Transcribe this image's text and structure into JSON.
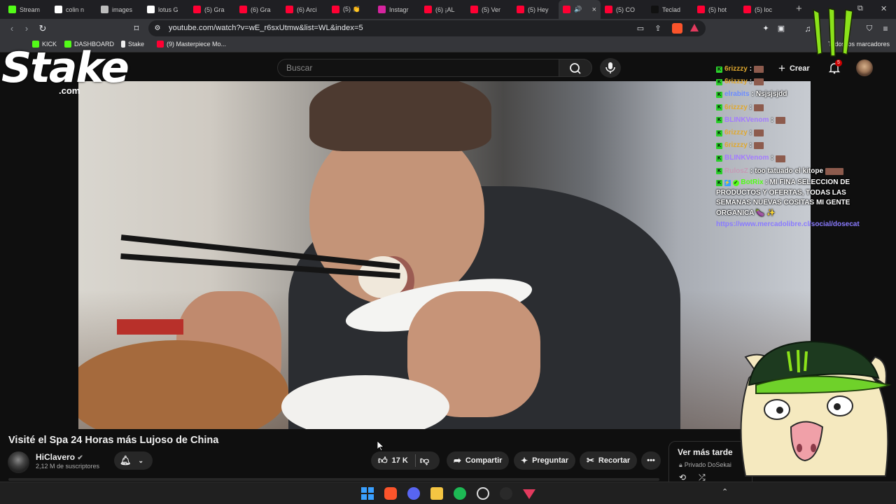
{
  "tabs": [
    {
      "label": "Stream",
      "color": "#53fc18"
    },
    {
      "label": "colin n",
      "color": "#ffffff"
    },
    {
      "label": "images",
      "color": "#bdbdbd"
    },
    {
      "label": "lotus G",
      "color": "#ffffff"
    },
    {
      "label": "(5) Gra",
      "color": "#ff0033"
    },
    {
      "label": "(6) Gra",
      "color": "#ff0033"
    },
    {
      "label": "(6) Arci",
      "color": "#ff0033"
    },
    {
      "label": "(5) 👏",
      "color": "#ff0033"
    },
    {
      "label": "Instagr",
      "color": "#d6249f"
    },
    {
      "label": "(6) ¡AL",
      "color": "#ff0033"
    },
    {
      "label": "(5) Ver",
      "color": "#ff0033"
    },
    {
      "label": "(5) Hey",
      "color": "#ff0033"
    },
    {
      "label": "🔊",
      "color": "#ff0033",
      "active": true
    },
    {
      "label": "(5) CO",
      "color": "#ff0033"
    },
    {
      "label": "Teclad",
      "color": "#111111"
    },
    {
      "label": "(5) hot",
      "color": "#ff0033"
    },
    {
      "label": "(5) loc",
      "color": "#ff0033"
    }
  ],
  "address_bar": {
    "url": "youtube.com/watch?v=wE_r6sxUtmw&list=WL&index=5"
  },
  "bookmarks": [
    {
      "label": "KICK",
      "color": "#53fc18"
    },
    {
      "label": "DASHBOARD",
      "color": "#53fc18"
    },
    {
      "label": "Stake",
      "color": "#ffffff"
    },
    {
      "label": "(9) Masterpiece Mo...",
      "color": "#ff0033"
    }
  ],
  "bookmarks_right": "Todos los marcadores",
  "search": {
    "placeholder": "Buscar"
  },
  "masthead": {
    "create_label": "Crear",
    "notifications_count": "5"
  },
  "chat": [
    {
      "user": "6rizzzy",
      "user_color": "#e0a82e",
      "text": "",
      "emote": true
    },
    {
      "user": "6rizzzy",
      "user_color": "#e0a82e",
      "text": "",
      "emote": true
    },
    {
      "user": "elrabits",
      "user_color": "#6c8cff",
      "text": "Nsjsjsjdd",
      "emote": false
    },
    {
      "user": "6rizzzy",
      "user_color": "#e0a82e",
      "text": "",
      "emote": true
    },
    {
      "user": "BLINKVenom",
      "user_color": "#a37bff",
      "text": "",
      "emote": true
    },
    {
      "user": "6rizzzy",
      "user_color": "#e0a82e",
      "text": "",
      "emote": true
    },
    {
      "user": "6rizzzy",
      "user_color": "#e0a82e",
      "text": "",
      "emote": true
    },
    {
      "user": "BLINKVenom",
      "user_color": "#a37bff",
      "text": "",
      "emote": true
    },
    {
      "user": "RulosZ",
      "user_color": "#c59bb5",
      "text": "too tatuado el kitope",
      "emote": true
    }
  ],
  "bot_message": {
    "user": "BotRix",
    "user_color": "#53fc18",
    "text": "MI FINA SELECCION DE PRODUCTOS Y OFERTAS, TODAS LAS SEMANAS NUEVAS COSITAS MI GENTE ORGANICA 🍆 ✨",
    "link": "https://www.mercadolibre.cl/social/dosecat"
  },
  "video": {
    "title": "Visité el Spa 24 Horas más Lujoso de China"
  },
  "channel": {
    "name": "HiClavero",
    "subscribers": "2,12 M de suscriptores"
  },
  "actions": {
    "likes": "17 K",
    "share": "Compartir",
    "ask": "Preguntar",
    "clip": "Recortar"
  },
  "watch_later": {
    "title": "Ver más tarde",
    "privacy": "Privado DoSekai"
  },
  "overlay": {
    "stake_logo": "Stake",
    "stake_domain": ".com"
  }
}
